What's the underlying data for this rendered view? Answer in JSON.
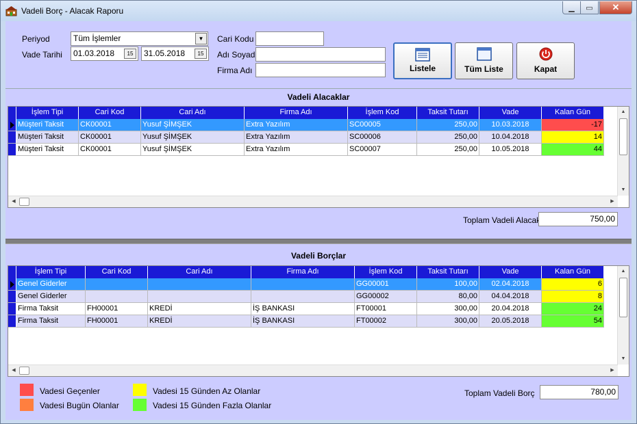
{
  "window": {
    "title": "Vadeli Borç - Alacak Raporu"
  },
  "filters": {
    "period_label": "Periyod",
    "period_value": "Tüm İşlemler",
    "due_date_label": "Vade Tarihi",
    "date_from": "01.03.2018",
    "date_to": "31.05.2018",
    "customer_code_label": "Cari Kodu",
    "customer_code_value": "",
    "name_label": "Adı Soyadı",
    "name_value": "",
    "company_label": "Firma Adı",
    "company_value": ""
  },
  "buttons": {
    "list": "Listele",
    "all_list": "Tüm Liste",
    "close": "Kapat"
  },
  "receivables": {
    "title": "Vadeli Alacaklar",
    "columns": [
      "İşlem Tipi",
      "Cari Kod",
      "Cari Adı",
      "Firma Adı",
      "İşlem Kod",
      "Taksit Tutarı",
      "Vade",
      "Kalan Gün"
    ],
    "rows": [
      [
        "Müşteri Taksit",
        "CK00001",
        "Yusuf ŞİMŞEK",
        "Extra Yazılım",
        "SC00005",
        "250,00",
        "10.03.2018",
        "-17"
      ],
      [
        "Müşteri Taksit",
        "CK00001",
        "Yusuf ŞİMŞEK",
        "Extra Yazılım",
        "SC00006",
        "250,00",
        "10.04.2018",
        "14"
      ],
      [
        "Müşteri Taksit",
        "CK00001",
        "Yusuf ŞİMŞEK",
        "Extra Yazılım",
        "SC00007",
        "250,00",
        "10.05.2018",
        "44"
      ]
    ],
    "days_colors": [
      "#ff4d4d",
      "#ffff00",
      "#66ff33"
    ],
    "total_label": "Toplam Vadeli Alacak",
    "total_value": "750,00"
  },
  "payables": {
    "title": "Vadeli Borçlar",
    "columns": [
      "İşlem Tipi",
      "Cari Kod",
      "Cari Adı",
      "Firma Adı",
      "İşlem Kod",
      "Taksit Tutarı",
      "Vade",
      "Kalan Gün"
    ],
    "rows": [
      [
        "Genel Giderler",
        "",
        "",
        "",
        "GG00001",
        "100,00",
        "02.04.2018",
        "6"
      ],
      [
        "Genel Giderler",
        "",
        "",
        "",
        "GG00002",
        "80,00",
        "04.04.2018",
        "8"
      ],
      [
        "Firma Taksit",
        "FH00001",
        "KREDİ",
        "İŞ BANKASI",
        "FT00001",
        "300,00",
        "20.04.2018",
        "24"
      ],
      [
        "Firma Taksit",
        "FH00001",
        "KREDİ",
        "İŞ BANKASI",
        "FT00002",
        "300,00",
        "20.05.2018",
        "54"
      ]
    ],
    "days_colors": [
      "#ffff00",
      "#ffff00",
      "#66ff33",
      "#66ff33"
    ],
    "total_label": "Toplam Vadeli Borç",
    "total_value": "780,00"
  },
  "legend": [
    {
      "label": "Vadesi Geçenler",
      "color": "#ff4d4d"
    },
    {
      "label": "Vadesi Bugün Olanlar",
      "color": "#ff7f3f"
    },
    {
      "label": "Vadesi 15 Günden Az Olanlar",
      "color": "#ffff00"
    },
    {
      "label": "Vadesi 15 Günden Fazla Olanlar",
      "color": "#66ff33"
    }
  ],
  "icons": {
    "app": "building-icon",
    "list": "list-icon",
    "all_list": "window-icon",
    "close": "power-icon"
  }
}
